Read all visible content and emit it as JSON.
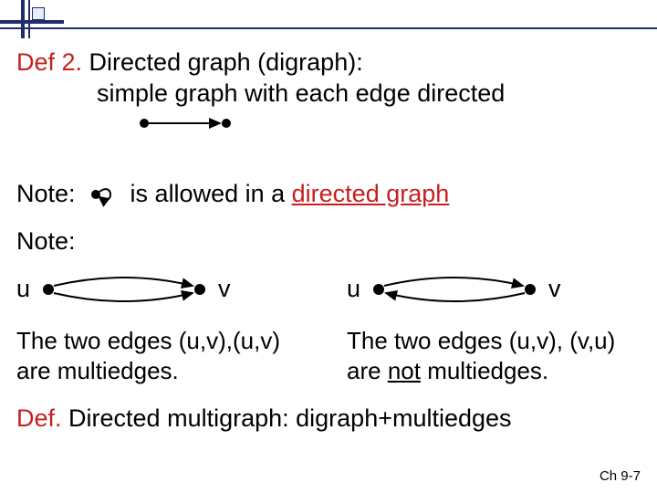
{
  "def2": {
    "prefix": "Def 2.",
    "title_rest": " Directed graph (digraph):",
    "line2": "simple graph with each edge directed"
  },
  "note1": {
    "label": "Note:",
    "rest_a": "is allowed in a ",
    "rest_b": "directed graph"
  },
  "note2": {
    "label": "Note:"
  },
  "labels": {
    "u": "u",
    "v": "v"
  },
  "cap_left": "The two edges (u,v),(u,v) are multiedges.",
  "cap_right_a": "The two edges (u,v), (v,u) are ",
  "cap_right_b": "not",
  "cap_right_c": " multiedges.",
  "def3": {
    "prefix": "Def.",
    "rest": " Directed multigraph: digraph+multiedges"
  },
  "pagenum": "Ch 9-7"
}
